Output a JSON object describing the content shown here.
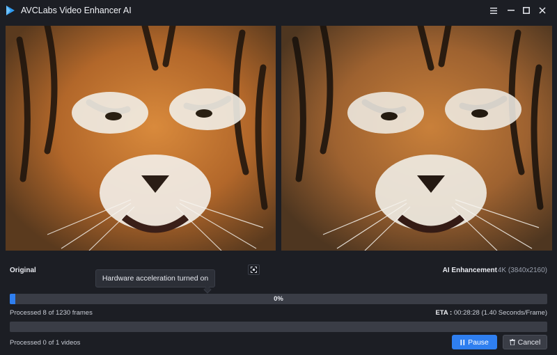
{
  "app": {
    "title": "AVCLabs Video Enhancer AI",
    "accent": "#2f7ff0"
  },
  "window_controls": {
    "menu_icon": "hamburger-icon",
    "minimize_icon": "minimize-icon",
    "maximize_icon": "maximize-icon",
    "close_icon": "close-icon"
  },
  "preview": {
    "original_label": "Original",
    "enhanced_label": "AI Enhancement",
    "resolution": "4K (3840x2160)",
    "compare_icon": "fullscreen-compare-icon"
  },
  "tooltip": {
    "text": "Hardware acceleration turned on"
  },
  "progress": {
    "percent_label": "0%",
    "percent": 1,
    "frames_text": "Processed 8 of 1230 frames",
    "eta_label": "ETA :",
    "eta_value": "00:28:28 (1.40 Seconds/Frame)",
    "videos_text": "Processed 0 of 1 videos",
    "videos_percent": 0
  },
  "actions": {
    "pause_label": "Pause",
    "cancel_label": "Cancel"
  }
}
